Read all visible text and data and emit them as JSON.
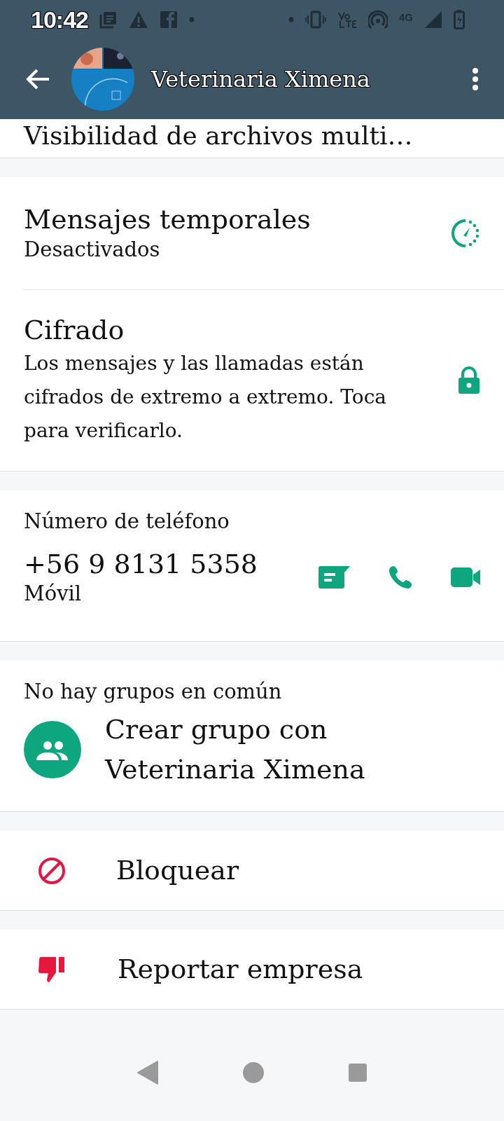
{
  "status_bar": {
    "time": "10:42",
    "network": "4G"
  },
  "header": {
    "title": "Veterinaria Ximena"
  },
  "partial_row": {
    "title": "Visibilidad de archivos multi…"
  },
  "disappearing": {
    "title": "Mensajes temporales",
    "value": "Desactivados"
  },
  "encryption": {
    "title": "Cifrado",
    "text": "Los mensajes y las llamadas están cifrados de extremo a extremo. Toca para verificarlo."
  },
  "phone": {
    "label": "Número de teléfono",
    "number": "+56 9 8131 5358",
    "type": "Móvil"
  },
  "groups": {
    "label": "No hay grupos en común",
    "action": "Crear grupo con Veterinaria Ximena"
  },
  "actions": [
    {
      "kind": "block",
      "label": "Bloquear"
    },
    {
      "kind": "report",
      "label": "Reportar empresa"
    }
  ]
}
